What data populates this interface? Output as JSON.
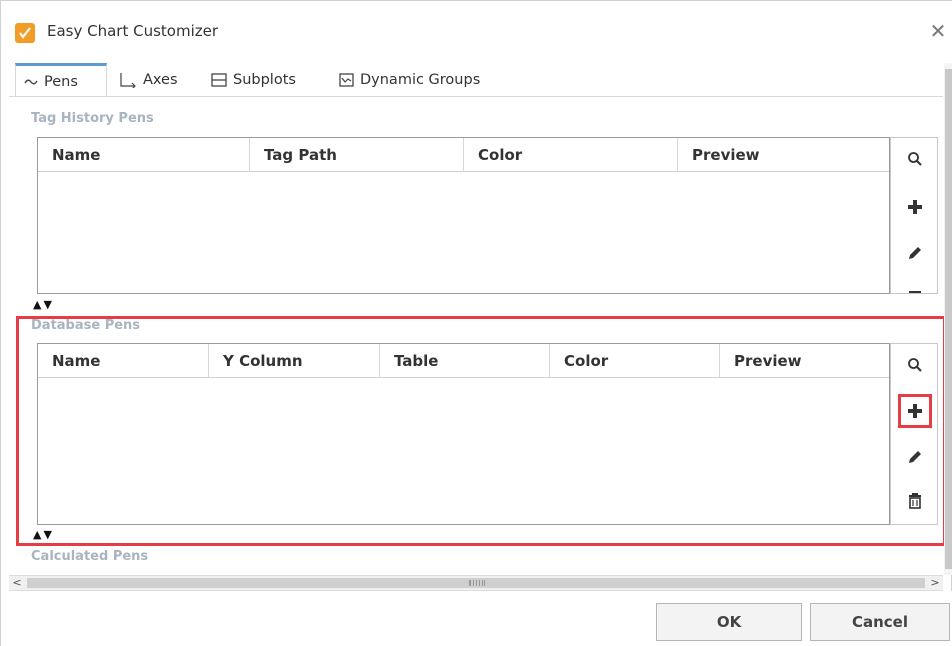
{
  "window": {
    "title": "Easy Chart Customizer",
    "accent_color": "#5b9bd5",
    "highlight_color": "#e53d45",
    "app_icon": "checkmark-pen-icon"
  },
  "tabs": [
    {
      "label": "Pens",
      "icon": "pens-icon",
      "active": true
    },
    {
      "label": "Axes",
      "icon": "axes-icon",
      "active": false
    },
    {
      "label": "Subplots",
      "icon": "subplots-icon",
      "active": false
    },
    {
      "label": "Dynamic Groups",
      "icon": "dynamic-groups-icon",
      "active": false
    }
  ],
  "tag_history": {
    "label": "Tag History Pens",
    "columns": [
      "Name",
      "Tag Path",
      "Color",
      "Preview"
    ],
    "rows": []
  },
  "database": {
    "label": "Database Pens",
    "columns": [
      "Name",
      "Y Column",
      "Table",
      "Color",
      "Preview"
    ],
    "rows": []
  },
  "calculated": {
    "label": "Calculated Pens"
  },
  "toolbar_icons": [
    "search-icon",
    "add-icon",
    "edit-icon",
    "delete-icon"
  ],
  "footer": {
    "ok_label": "OK",
    "cancel_label": "Cancel"
  }
}
